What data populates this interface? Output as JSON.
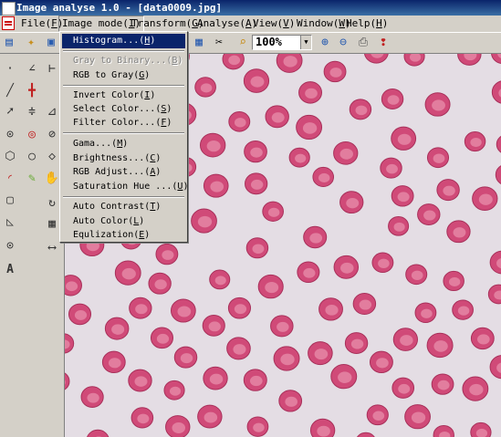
{
  "window": {
    "title": "Image analyse 1.0 - [data0009.jpg]"
  },
  "menubar": {
    "file": "File",
    "file_key": "F",
    "image_mode": "Image mode",
    "image_mode_key": "I",
    "transform": "Transform",
    "transform_key": "G",
    "analyse": "Analyse",
    "analyse_key": "A",
    "view": "View",
    "view_key": "V",
    "window": "Window",
    "window_key": "W",
    "help": "Help",
    "help_key": "H"
  },
  "toolbar": {
    "zoom_value": "100%"
  },
  "image_mode_menu": {
    "histogram": "Histogram...",
    "histogram_key": "H",
    "gray_to_binary": "Gray to Binary...",
    "gray_to_binary_key": "B",
    "rgb_to_gray": "RGB to Gray",
    "rgb_to_gray_key": "G",
    "invert_color": "Invert Color",
    "invert_color_key": "I",
    "select_color": "Select Color...",
    "select_color_key": "S",
    "filter_color": "Filter Color...",
    "filter_color_key": "F",
    "gama": "Gama...",
    "gama_key": "M",
    "brightness": "Brightness...",
    "brightness_key": "C",
    "rgb_adjust": "RGB Adjust...",
    "rgb_adjust_key": "A",
    "saturation_hue": "Saturation Hue ...",
    "saturation_hue_key": "U",
    "auto_contrast": "Auto Contrast",
    "auto_contrast_key": "T",
    "auto_color": "Auto Color",
    "auto_color_key": "L",
    "equlization": "Equlization",
    "equlization_key": "E"
  },
  "colors": {
    "title_bar": "#0a246a",
    "menu_highlight": "#0a246a",
    "cell": "#d04a78",
    "background": "#e4dde4"
  },
  "icons": [
    "app-icon",
    "document-icon",
    "scissors-icon",
    "zoom-icon",
    "zoom-in-icon",
    "zoom-out-icon",
    "print-icon",
    "help-icon"
  ]
}
